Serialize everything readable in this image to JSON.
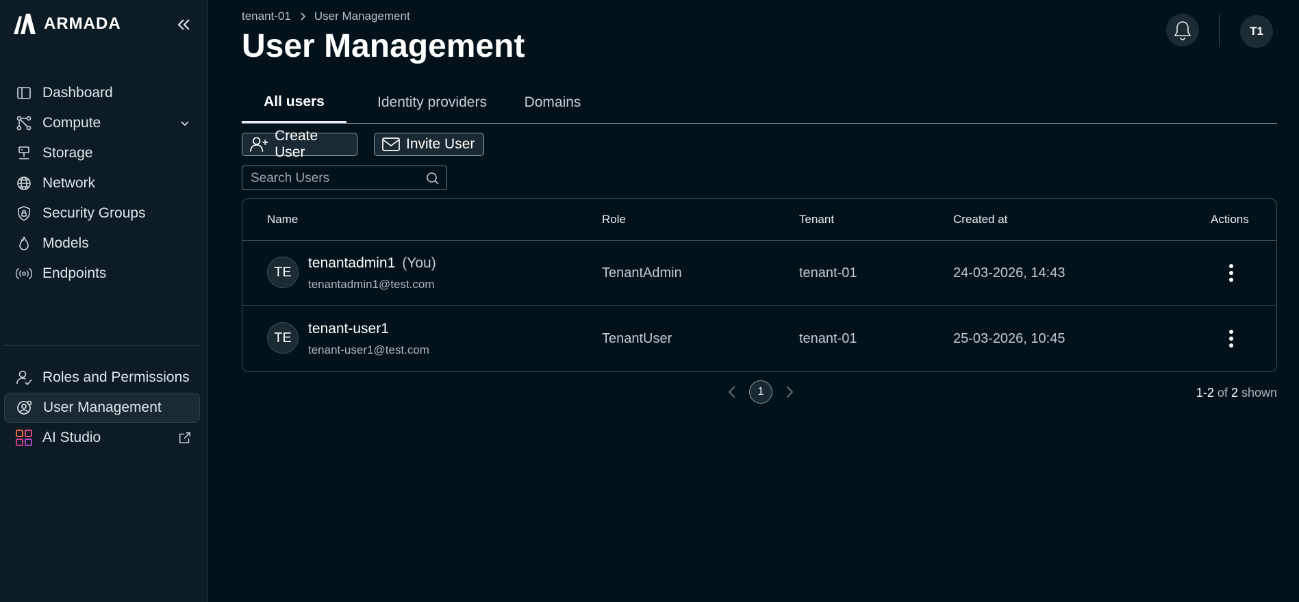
{
  "app": {
    "name": "ARMADA"
  },
  "sidebar": {
    "items": [
      {
        "label": "Dashboard",
        "icon": "dashboard-icon"
      },
      {
        "label": "Compute",
        "icon": "compute-icon"
      },
      {
        "label": "Storage",
        "icon": "storage-icon"
      },
      {
        "label": "Network",
        "icon": "globe-icon"
      },
      {
        "label": "Security Groups",
        "icon": "shield-icon"
      },
      {
        "label": "Models",
        "icon": "flame-icon"
      },
      {
        "label": "Endpoints",
        "icon": "broadcast-icon"
      }
    ],
    "admin_items": [
      {
        "label": "Roles and Permissions",
        "icon": "user-check-icon"
      },
      {
        "label": "User Management",
        "icon": "user-gear-icon",
        "active": true
      },
      {
        "label": "AI Studio",
        "icon": "grid-icon"
      }
    ]
  },
  "breadcrumb": {
    "parent": "tenant-01",
    "current": "User Management"
  },
  "page": {
    "title": "User Management"
  },
  "header": {
    "avatar_initials": "T1"
  },
  "tabs": [
    {
      "label": "All users",
      "active": true
    },
    {
      "label": "Identity providers"
    },
    {
      "label": "Domains"
    }
  ],
  "toolbar": {
    "create_label": "Create User",
    "invite_label": "Invite User"
  },
  "search": {
    "placeholder": "Search Users",
    "value": ""
  },
  "table": {
    "columns": [
      "Name",
      "Role",
      "Tenant",
      "Created at",
      "Actions"
    ],
    "rows": [
      {
        "initials": "TE",
        "name": "tenantadmin1",
        "you": "(You)",
        "email": "tenantadmin1@test.com",
        "role": "TenantAdmin",
        "tenant": "tenant-01",
        "created": "24-03-2026, 14:43"
      },
      {
        "initials": "TE",
        "name": "tenant-user1",
        "email": "tenant-user1@test.com",
        "role": "TenantUser",
        "tenant": "tenant-01",
        "created": "25-03-2026, 10:45"
      }
    ]
  },
  "pagination": {
    "current": "1",
    "range": "1-2",
    "of_label": "of",
    "total": "2",
    "shown_label": "shown"
  },
  "colors": {
    "background": "#03121a",
    "sidebar": "#0d1c24",
    "text": "#e6edf0"
  }
}
